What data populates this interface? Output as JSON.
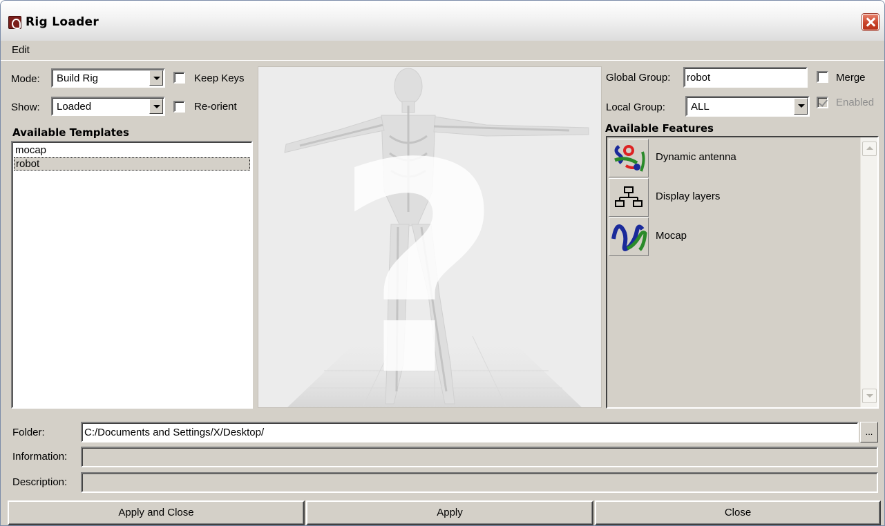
{
  "window": {
    "title": "Rig Loader",
    "icons": {
      "app": "app-logo-icon",
      "close": "close-icon"
    }
  },
  "menu": {
    "items": [
      "Edit"
    ]
  },
  "left": {
    "mode_label": "Mode:",
    "mode_value": "Build Rig",
    "keep_keys_label": "Keep Keys",
    "keep_keys_checked": false,
    "show_label": "Show:",
    "show_value": "Loaded",
    "reorient_label": "Re-orient",
    "reorient_checked": false,
    "templates_title": "Available Templates",
    "templates": [
      "mocap",
      "robot"
    ],
    "selected_template": "robot"
  },
  "preview": {
    "icon": "question-mark-icon",
    "image": "skeleton-figure-image"
  },
  "right": {
    "global_group_label": "Global Group:",
    "global_group_value": "robot",
    "merge_label": "Merge",
    "merge_checked": false,
    "local_group_label": "Local Group:",
    "local_group_value": "ALL",
    "enabled_label": "Enabled",
    "enabled_checked": true,
    "enabled_disabled": true,
    "features_title": "Available Features",
    "features": [
      {
        "label": "Dynamic antenna",
        "icon": "dynamic-antenna-icon"
      },
      {
        "label": "Display layers",
        "icon": "display-layers-icon"
      },
      {
        "label": "Mocap",
        "icon": "mocap-icon"
      }
    ]
  },
  "bottom": {
    "folder_label": "Folder:",
    "folder_value": "C:/Documents and Settings/X/Desktop/",
    "browse_label": "...",
    "information_label": "Information:",
    "information_value": "",
    "description_label": "Description:",
    "description_value": ""
  },
  "buttons": {
    "apply_close": "Apply and Close",
    "apply": "Apply",
    "close": "Close"
  },
  "colors": {
    "face": "#d4d0c8",
    "titlebar_close": "#c9432a",
    "preview_bg": "#ececec"
  }
}
